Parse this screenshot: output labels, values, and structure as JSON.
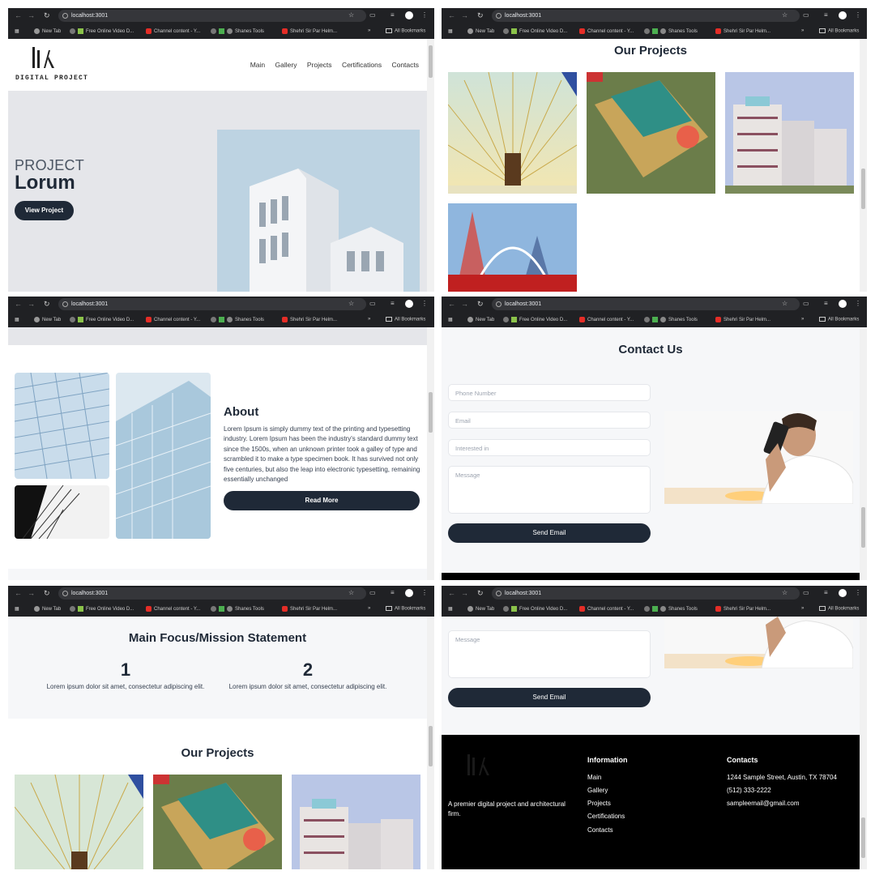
{
  "browser": {
    "url": "localhost:3001",
    "bookmarks": [
      "New Tab",
      "Free Online Video D...",
      "Channel content - Y...",
      "Shanes Tools",
      "Shehri Sir Par Helm..."
    ],
    "all_bookmarks": "All Bookmarks",
    "overflow": "»"
  },
  "header": {
    "logo_text": "DIGITAL PROJECT",
    "nav": [
      "Main",
      "Gallery",
      "Projects",
      "Certifications",
      "Contacts"
    ]
  },
  "hero": {
    "subtitle": "PROJECT",
    "title": "Lorum",
    "button": "View Project"
  },
  "projects": {
    "title": "Our Projects"
  },
  "about": {
    "title": "About",
    "body": "Lorem Ipsum is simply dummy text of the printing and typesetting industry. Lorem Ipsum has been the industry's standard dummy text since the 1500s, when an unknown printer took a galley of type and scrambled it to make a type specimen book. It has survived not only five centuries, but also the leap into electronic typesetting, remaining essentially unchanged",
    "button": "Read More"
  },
  "contact": {
    "title": "Contact Us",
    "phone_placeholder": "Phone Number",
    "email_placeholder": "Email",
    "interest_placeholder": "Interested in",
    "message_placeholder": "Message",
    "button": "Send Email"
  },
  "mission": {
    "title": "Main Focus/Mission Statement",
    "items": [
      {
        "number": "1",
        "text": "Lorem ipsum dolor sit amet, consectetur adipiscing elit."
      },
      {
        "number": "2",
        "text": "Lorem ipsum dolor sit amet, consectetur adipiscing elit."
      }
    ]
  },
  "footer": {
    "tagline": "A premier digital project and architectural firm.",
    "info_title": "Information",
    "info_links": [
      "Main",
      "Gallery",
      "Projects",
      "Certifications",
      "Contacts"
    ],
    "contacts_title": "Contacts",
    "address": "1244 Sample Street, Austin, TX 78704",
    "phone": "(512) 333-2222",
    "email": "sampleemail@gmail.com"
  },
  "colors": {
    "primary": "#1f2937",
    "chrome": "#202124",
    "hero_bg": "#e5e6ea",
    "section_bg": "#f6f7f9",
    "footer_bg": "#000000"
  }
}
